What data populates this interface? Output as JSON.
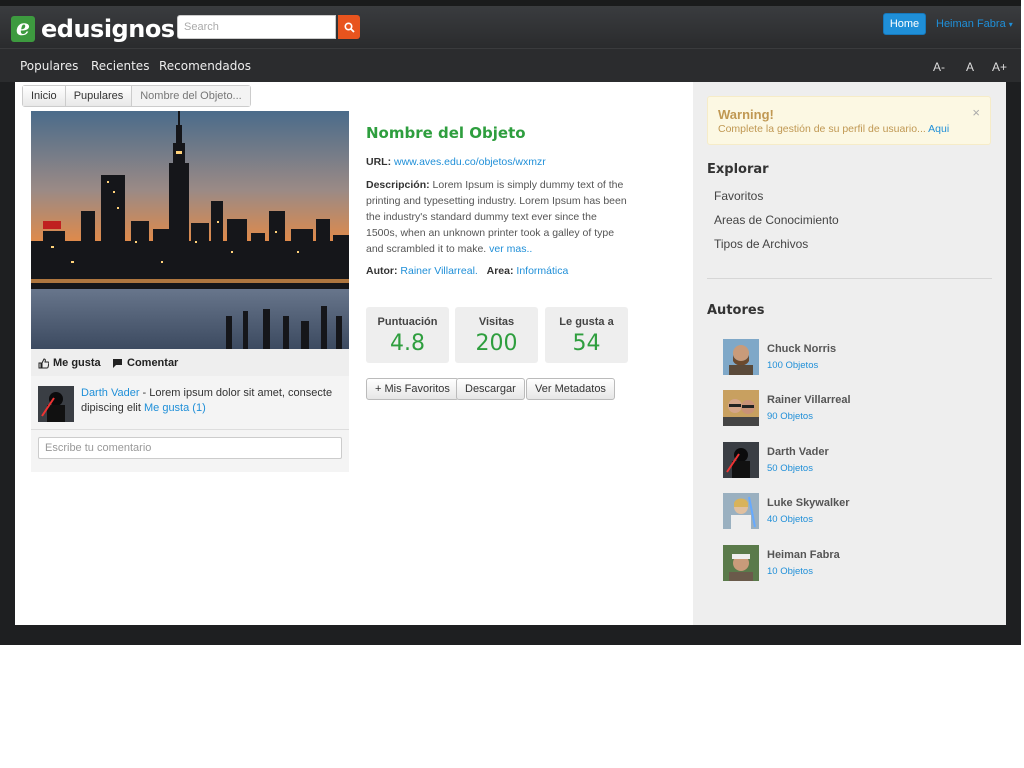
{
  "brand": {
    "logo_letter": "e",
    "name": "edusignos"
  },
  "search": {
    "placeholder": "Search"
  },
  "header": {
    "home_label": "Home",
    "user_name": "Heiman Fabra",
    "user_caret": "▾"
  },
  "nav": {
    "items": [
      "Populares",
      "Recientes",
      "Recomendados"
    ]
  },
  "font_size_controls": [
    "A-",
    "A",
    "A+"
  ],
  "breadcrumb": [
    "Inicio",
    "Pupulares",
    "Nombre del Objeto..."
  ],
  "object": {
    "title": "Nombre del Objeto",
    "url_label": "URL:",
    "url": "www.aves.edu.co/objetos/wxmzr",
    "description_label": "Descripción:",
    "description": "Lorem Ipsum is simply dummy text of the printing and typesetting industry. Lorem Ipsum has been the industry's standard dummy text ever since the 1500s, when an unknown printer took a galley of type and scrambled it to make.",
    "see_more": "ver mas..",
    "author_label": "Autor:",
    "author": "Rainer Villarreal.",
    "area_label": "Area:",
    "area": "Informática"
  },
  "stats": [
    {
      "label": "Puntuación",
      "value": "4.8"
    },
    {
      "label": "Visitas",
      "value": "200"
    },
    {
      "label": "Le gusta a",
      "value": "54"
    }
  ],
  "actions": {
    "favorites": "+ Mis Favoritos",
    "download": "Descargar",
    "metadata": "Ver Metadatos"
  },
  "social": {
    "like": "Me gusta",
    "comment": "Comentar"
  },
  "comment": {
    "author": "Darth Vader",
    "text": " - Lorem ipsum dolor sit amet, consecte dipiscing elit ",
    "likes": "Me gusta (1)",
    "input_placeholder": "Escribe tu comentario"
  },
  "warning": {
    "title": "Warning!",
    "text": "Complete la gestión de su perfil de usuario...",
    "link": "Aqui",
    "close": "×"
  },
  "explore": {
    "heading": "Explorar",
    "items": [
      "Favoritos",
      "Areas de Conocimiento",
      "Tipos de Archivos"
    ]
  },
  "authors": {
    "heading": "Autores",
    "items": [
      {
        "name": "Chuck Norris",
        "count": "100 Objetos"
      },
      {
        "name": "Rainer Villarreal",
        "count": "90 Objetos"
      },
      {
        "name": "Darth Vader",
        "count": "50 Objetos"
      },
      {
        "name": "Luke Skywalker",
        "count": "40 Objetos"
      },
      {
        "name": "Heiman Fabra",
        "count": "10 Objetos"
      }
    ]
  },
  "colors": {
    "accent_green": "#2e9e3e",
    "link_blue": "#1f8fd8",
    "search_orange": "#e8541e",
    "warning_text": "#c09853"
  },
  "icons": {
    "search": "search-icon",
    "like": "thumbs-up-icon",
    "comment": "comment-icon",
    "close": "close-icon"
  }
}
